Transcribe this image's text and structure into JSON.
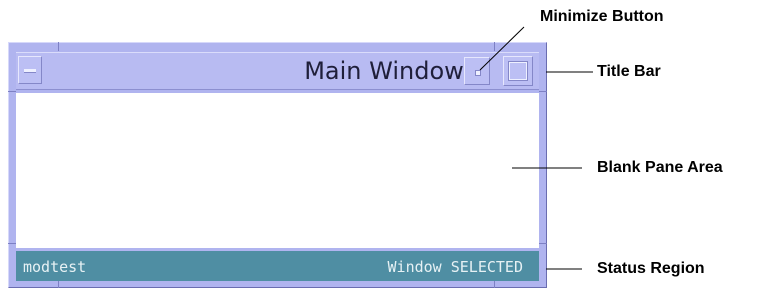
{
  "window": {
    "title": "Main Window",
    "status_left": "modtest",
    "status_right": "Window SELECTED"
  },
  "callouts": {
    "minimize_button": "Minimize Button",
    "title_bar": "Title Bar",
    "blank_pane": "Blank Pane Area",
    "status_region": "Status Region"
  },
  "colors": {
    "frame": "#b0b4ef",
    "title_bar": "#b8bbf2",
    "status_bar": "#4f8ea3",
    "pane": "#ffffff"
  },
  "icons": [
    "window-menu-icon",
    "minimize-icon",
    "maximize-icon"
  ]
}
